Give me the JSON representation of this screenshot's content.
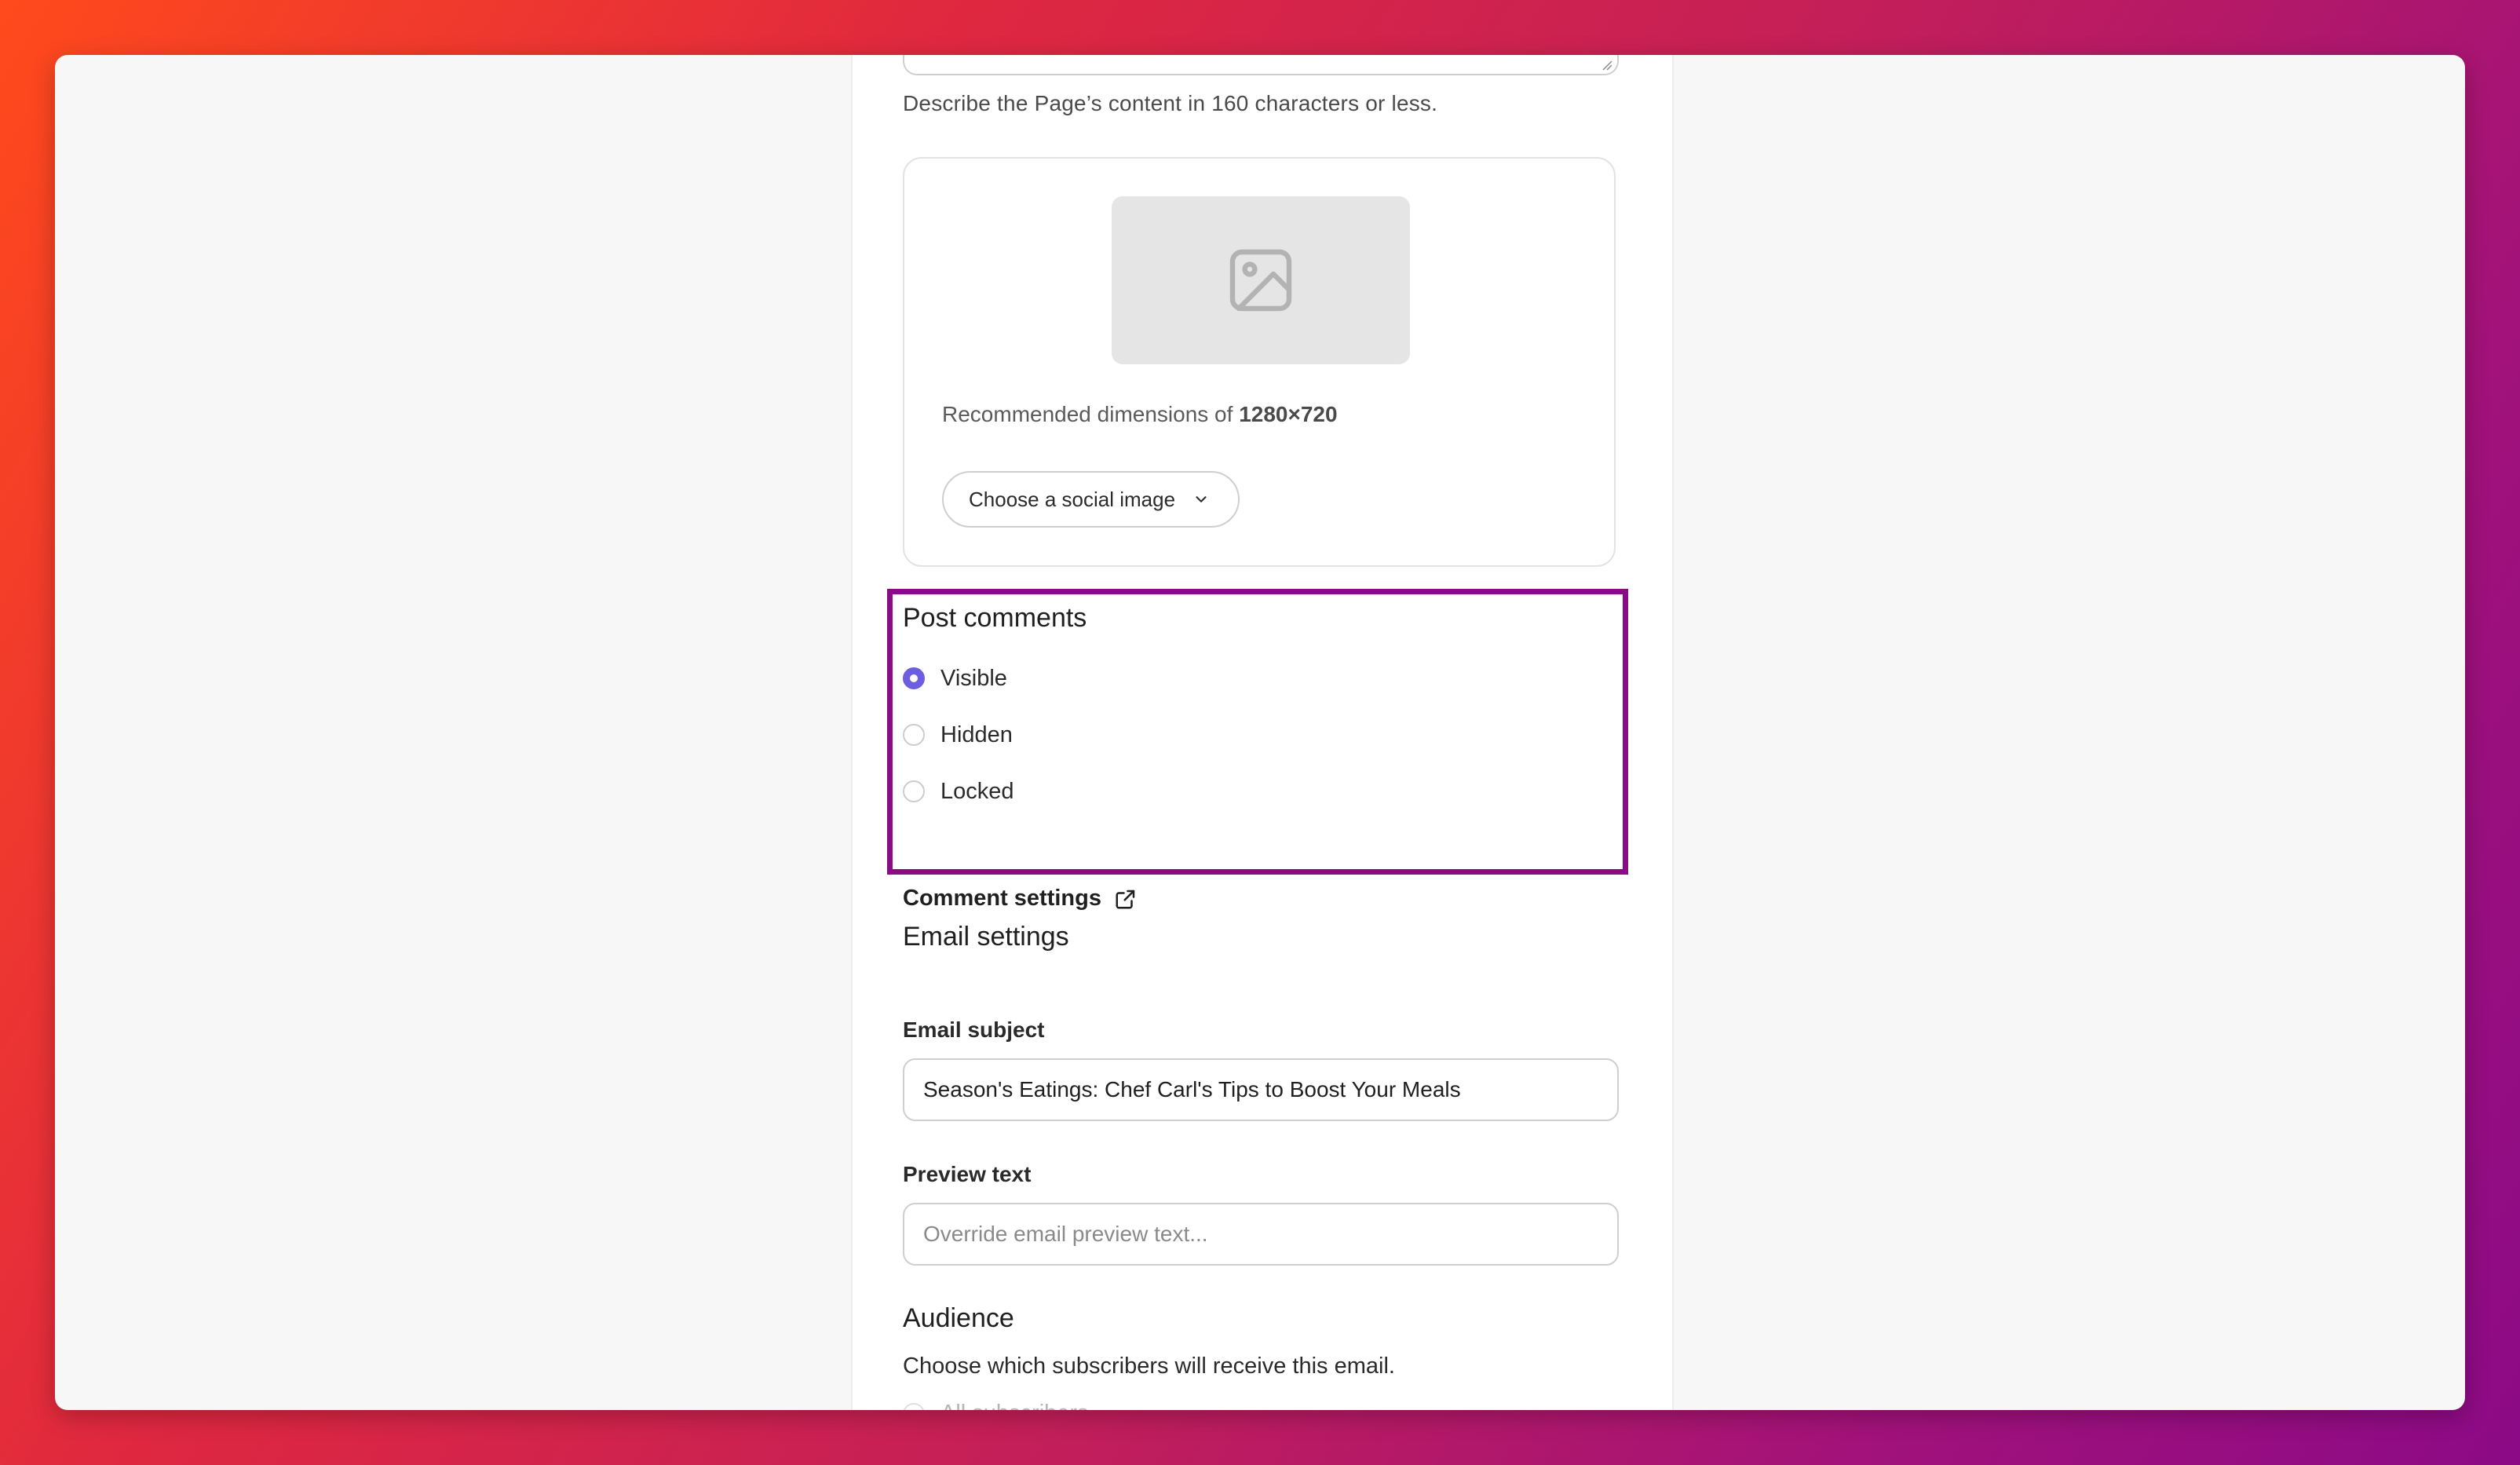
{
  "seo": {
    "description_helper": "Describe the Page’s content in 160 characters or less."
  },
  "social_image": {
    "placeholder_icon": "image-icon",
    "recommended_prefix": "Recommended dimensions of ",
    "recommended_size": "1280×720",
    "choose_button_label": "Choose a social image",
    "choose_button_icon": "chevron-down-icon"
  },
  "post_comments": {
    "title": "Post comments",
    "options": [
      {
        "label": "Visible",
        "selected": true
      },
      {
        "label": "Hidden",
        "selected": false
      },
      {
        "label": "Locked",
        "selected": false
      }
    ],
    "settings_link": "Comment settings",
    "settings_link_icon": "external-link-icon",
    "highlight_color": "#8b0a86"
  },
  "email_settings": {
    "title": "Email settings",
    "subject_label": "Email subject",
    "subject_value": "Season's Eatings: Chef Carl's Tips to Boost Your Meals",
    "preview_label": "Preview text",
    "preview_placeholder": "Override email preview text...",
    "preview_value": ""
  },
  "audience": {
    "title": "Audience",
    "description": "Choose which subscribers will receive this email.",
    "first_option": "All subscribers"
  },
  "colors": {
    "accent": "#6d5ee0"
  }
}
